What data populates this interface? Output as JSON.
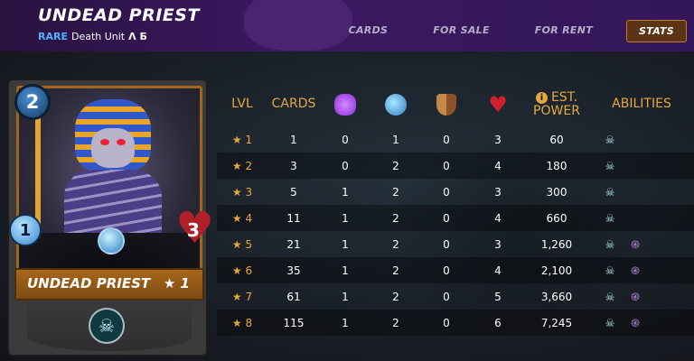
{
  "header": {
    "title": "UNDEAD PRIEST",
    "rarity": "RARE",
    "unit_type": "Death Unit",
    "edition_icon": "Λ Б",
    "tabs": [
      {
        "label": "CARDS",
        "active": false
      },
      {
        "label": "FOR SALE",
        "active": false
      },
      {
        "label": "FOR RENT",
        "active": false
      },
      {
        "label": "STATS",
        "active": true
      }
    ]
  },
  "card": {
    "name": "UNDEAD PRIEST",
    "level": "★ 1",
    "mana": "2",
    "speed": "1",
    "health": "3"
  },
  "table": {
    "headers": {
      "lvl": "LVL",
      "cards": "CARDS",
      "est_power_line1": "EST.",
      "est_power_line2": "POWER",
      "abilities": "ABILITIES"
    },
    "header_icons": [
      "magic-attack-icon",
      "ranged-attack-icon",
      "armor-icon",
      "health-icon"
    ],
    "rows": [
      {
        "lvl": "★ 1",
        "cards": "1",
        "magic": "0",
        "ranged": "1",
        "armor": "0",
        "health": "3",
        "power": "60",
        "abilities": [
          "undead-ability-icon"
        ]
      },
      {
        "lvl": "★ 2",
        "cards": "3",
        "magic": "0",
        "ranged": "2",
        "armor": "0",
        "health": "4",
        "power": "180",
        "abilities": [
          "undead-ability-icon"
        ]
      },
      {
        "lvl": "★ 3",
        "cards": "5",
        "magic": "1",
        "ranged": "2",
        "armor": "0",
        "health": "3",
        "power": "300",
        "abilities": [
          "undead-ability-icon"
        ]
      },
      {
        "lvl": "★ 4",
        "cards": "11",
        "magic": "1",
        "ranged": "2",
        "armor": "0",
        "health": "4",
        "power": "660",
        "abilities": [
          "undead-ability-icon"
        ]
      },
      {
        "lvl": "★ 5",
        "cards": "21",
        "magic": "1",
        "ranged": "2",
        "armor": "0",
        "health": "3",
        "power": "1,260",
        "abilities": [
          "undead-ability-icon",
          "swirl-ability-icon"
        ]
      },
      {
        "lvl": "★ 6",
        "cards": "35",
        "magic": "1",
        "ranged": "2",
        "armor": "0",
        "health": "4",
        "power": "2,100",
        "abilities": [
          "undead-ability-icon",
          "swirl-ability-icon"
        ]
      },
      {
        "lvl": "★ 7",
        "cards": "61",
        "magic": "1",
        "ranged": "2",
        "armor": "0",
        "health": "5",
        "power": "3,660",
        "abilities": [
          "undead-ability-icon",
          "swirl-ability-icon"
        ]
      },
      {
        "lvl": "★ 8",
        "cards": "115",
        "magic": "1",
        "ranged": "2",
        "armor": "0",
        "health": "6",
        "power": "7,245",
        "abilities": [
          "undead-ability-icon",
          "swirl-ability-icon"
        ]
      }
    ]
  }
}
